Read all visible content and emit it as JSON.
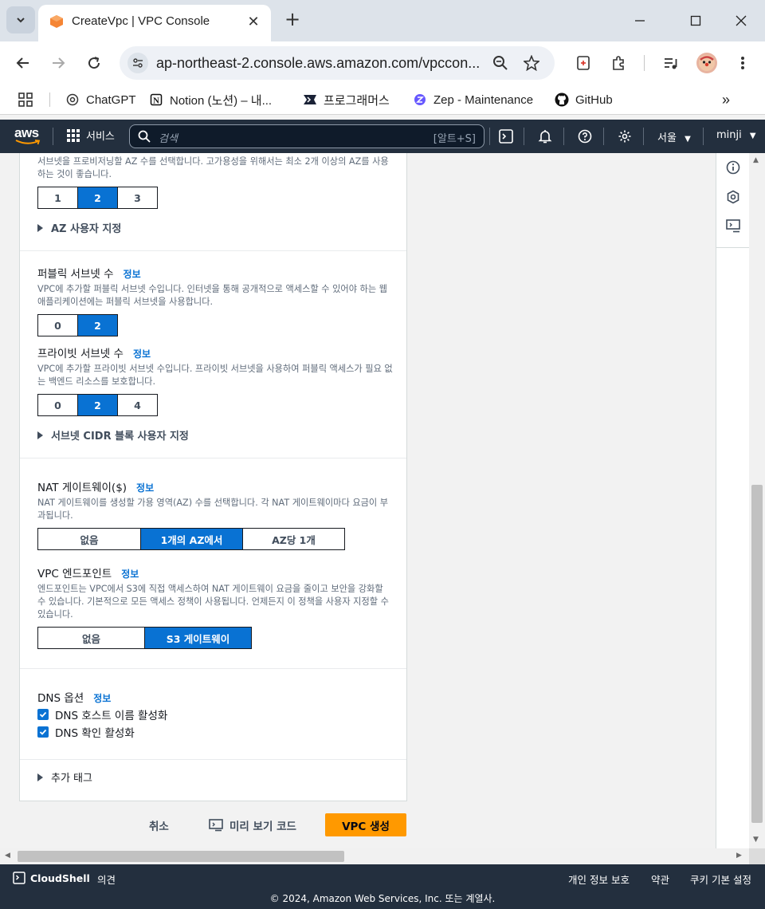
{
  "browser": {
    "tab_title": "CreateVpc | VPC Console",
    "url": "ap-northeast-2.console.aws.amazon.com/vpccon...",
    "bookmarks": [
      {
        "label": "ChatGPT",
        "icon": "chatgpt-icon"
      },
      {
        "label": "Notion (노션) – 내...",
        "icon": "notion-icon"
      },
      {
        "label": "프로그래머스",
        "icon": "programmers-icon"
      },
      {
        "label": "Zep - Maintenance",
        "icon": "zep-icon"
      },
      {
        "label": "GitHub",
        "icon": "github-icon"
      }
    ]
  },
  "aws_header": {
    "logo": "aws",
    "services": "서비스",
    "search_placeholder": "검색",
    "search_shortcut": "[알트+S]",
    "region": "서울",
    "user": "minji"
  },
  "form": {
    "az": {
      "description": "서브넷을 프로비저닝할 AZ 수를 선택합니다. 고가용성을 위해서는 최소 2개 이상의 AZ를 사용하는 것이 좋습니다.",
      "options": [
        "1",
        "2",
        "3"
      ],
      "selected": "2",
      "customize": "AZ 사용자 지정"
    },
    "public_subnets": {
      "label": "퍼블릭 서브넷 수",
      "info": "정보",
      "description": "VPC에 추가할 퍼블릭 서브넷 수입니다. 인터넷을 통해 공개적으로 액세스할 수 있어야 하는 웹 애플리케이션에는 퍼블릭 서브넷을 사용합니다.",
      "options": [
        "0",
        "2"
      ],
      "selected": "2"
    },
    "private_subnets": {
      "label": "프라이빗 서브넷 수",
      "info": "정보",
      "description": "VPC에 추가할 프라이빗 서브넷 수입니다. 프라이빗 서브넷을 사용하여 퍼블릭 액세스가 필요 없는 백엔드 리소스를 보호합니다.",
      "options": [
        "0",
        "2",
        "4"
      ],
      "selected": "2",
      "customize": "서브넷 CIDR 블록 사용자 지정"
    },
    "nat": {
      "label": "NAT 게이트웨이($)",
      "info": "정보",
      "description": "NAT 게이트웨이를 생성할 가용 영역(AZ) 수를 선택합니다. 각 NAT 게이트웨이마다 요금이 부과됩니다.",
      "options": [
        "없음",
        "1개의 AZ에서",
        "AZ당 1개"
      ],
      "selected": "1개의 AZ에서"
    },
    "endpoints": {
      "label": "VPC 엔드포인트",
      "info": "정보",
      "description": "엔드포인트는 VPC에서 S3에 직접 액세스하여 NAT 게이트웨이 요금을 줄이고 보안을 강화할 수 있습니다. 기본적으로 모든 액세스 정책이 사용됩니다. 언제든지 이 정책을 사용자 지정할 수 있습니다.",
      "options": [
        "없음",
        "S3 게이트웨이"
      ],
      "selected": "S3 게이트웨이"
    },
    "dns": {
      "label": "DNS 옵션",
      "info": "정보",
      "hostnames": "DNS 호스트 이름 활성화",
      "resolution": "DNS 확인 활성화"
    },
    "tags": "추가 태그"
  },
  "actions": {
    "cancel": "취소",
    "preview": "미리 보기 코드",
    "create": "VPC 생성"
  },
  "console_footer": {
    "cloudshell": "CloudShell",
    "feedback": "의견",
    "privacy": "개인 정보 보호",
    "terms": "약관",
    "cookies": "쿠키 기본 설정",
    "copyright": "© 2024, Amazon Web Services, Inc. 또는 계열사."
  },
  "colors": {
    "aws_dark": "#232f3e",
    "selected_blue": "#0972d3",
    "primary_orange": "#ff9900"
  }
}
